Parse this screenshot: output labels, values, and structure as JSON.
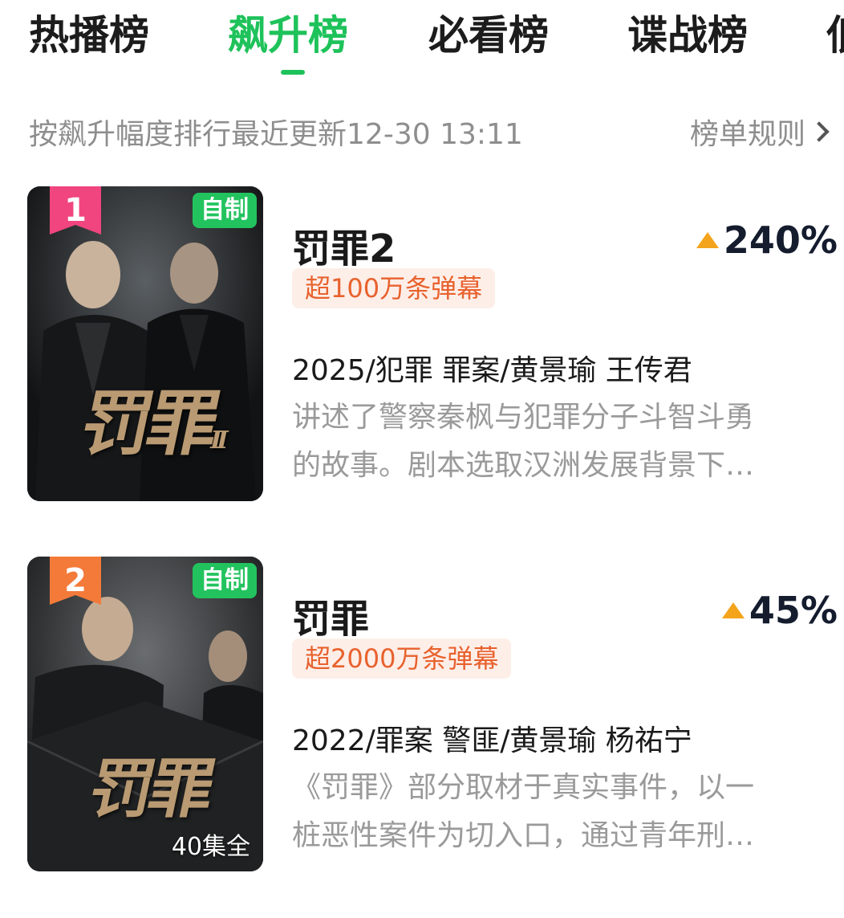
{
  "tabs": [
    {
      "label": "热播榜",
      "active": false
    },
    {
      "label": "飙升榜",
      "active": true
    },
    {
      "label": "必看榜",
      "active": false
    },
    {
      "label": "谍战榜",
      "active": false
    },
    {
      "label": "低",
      "active": false
    }
  ],
  "subheader": {
    "sort_label": "按飙升幅度排行",
    "updated_label": "最近更新12-30 13:11",
    "rules_link": "榜单规则"
  },
  "colors": {
    "accent_green": "#1ec25a",
    "rank1": "#f0457e",
    "rank2": "#f47a3a",
    "rise_arrow": "#f3a41b",
    "danmaku_text": "#e8622e"
  },
  "items": [
    {
      "rank": "1",
      "badge": "自制",
      "title": "罚罪2",
      "rise": "240%",
      "danmaku": "超100万条弹幕",
      "meta": "2025/犯罪 罪案/黄景瑜 王传君",
      "desc_line1": "讲述了警察秦枫与犯罪分子斗智斗勇",
      "desc_line2": "的故事。剧本选取汉洲发展背景下…",
      "poster_logo": "罚罪",
      "poster_logo_suffix": "II",
      "episodes": ""
    },
    {
      "rank": "2",
      "badge": "自制",
      "title": "罚罪",
      "rise": "45%",
      "danmaku": "超2000万条弹幕",
      "meta": "2022/罪案 警匪/黄景瑜 杨祐宁",
      "desc_line1": "《罚罪》部分取材于真实事件，以一",
      "desc_line2": "桩恶性案件为切入口，通过青年刑…",
      "poster_logo": "罚罪",
      "episodes": "40集全"
    }
  ]
}
